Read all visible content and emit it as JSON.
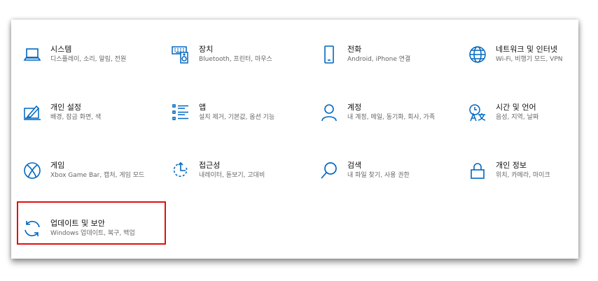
{
  "settings": {
    "tiles": [
      {
        "title": "시스템",
        "desc": "디스플레이, 소리, 알림, 전원",
        "icon": "laptop-icon"
      },
      {
        "title": "장치",
        "desc": "Bluetooth, 프린터, 마우스",
        "icon": "keyboard-speaker-icon"
      },
      {
        "title": "전화",
        "desc": "Android, iPhone 연결",
        "icon": "phone-icon"
      },
      {
        "title": "네트워크 및 인터넷",
        "desc": "Wi-Fi, 비행기 모드, VPN",
        "icon": "globe-icon"
      },
      {
        "title": "개인 설정",
        "desc": "배경, 잠금 화면, 색",
        "icon": "paint-brush-icon"
      },
      {
        "title": "앱",
        "desc": "설치 제거, 기본값, 옵션 기능",
        "icon": "apps-list-icon"
      },
      {
        "title": "계정",
        "desc": "내 계정, 메일, 동기화, 회사, 가족",
        "icon": "person-icon"
      },
      {
        "title": "시간 및 언어",
        "desc": "음성, 지역, 날짜",
        "icon": "time-language-icon"
      },
      {
        "title": "게임",
        "desc": "Xbox Game Bar, 캡처, 게임 모드",
        "icon": "xbox-icon"
      },
      {
        "title": "접근성",
        "desc": "내레이터, 돋보기, 고대비",
        "icon": "accessibility-icon"
      },
      {
        "title": "검색",
        "desc": "내 파일 찾기, 사용 권한",
        "icon": "search-icon"
      },
      {
        "title": "개인 정보",
        "desc": "위치, 카메라, 마이크",
        "icon": "lock-icon"
      },
      {
        "title": "업데이트 및 보안",
        "desc": "Windows 업데이트, 복구, 백업",
        "icon": "sync-icon"
      }
    ]
  },
  "colors": {
    "accent": "#0067c0",
    "highlight_border": "#e01010",
    "title_text": "#111111",
    "desc_text": "#666666"
  }
}
